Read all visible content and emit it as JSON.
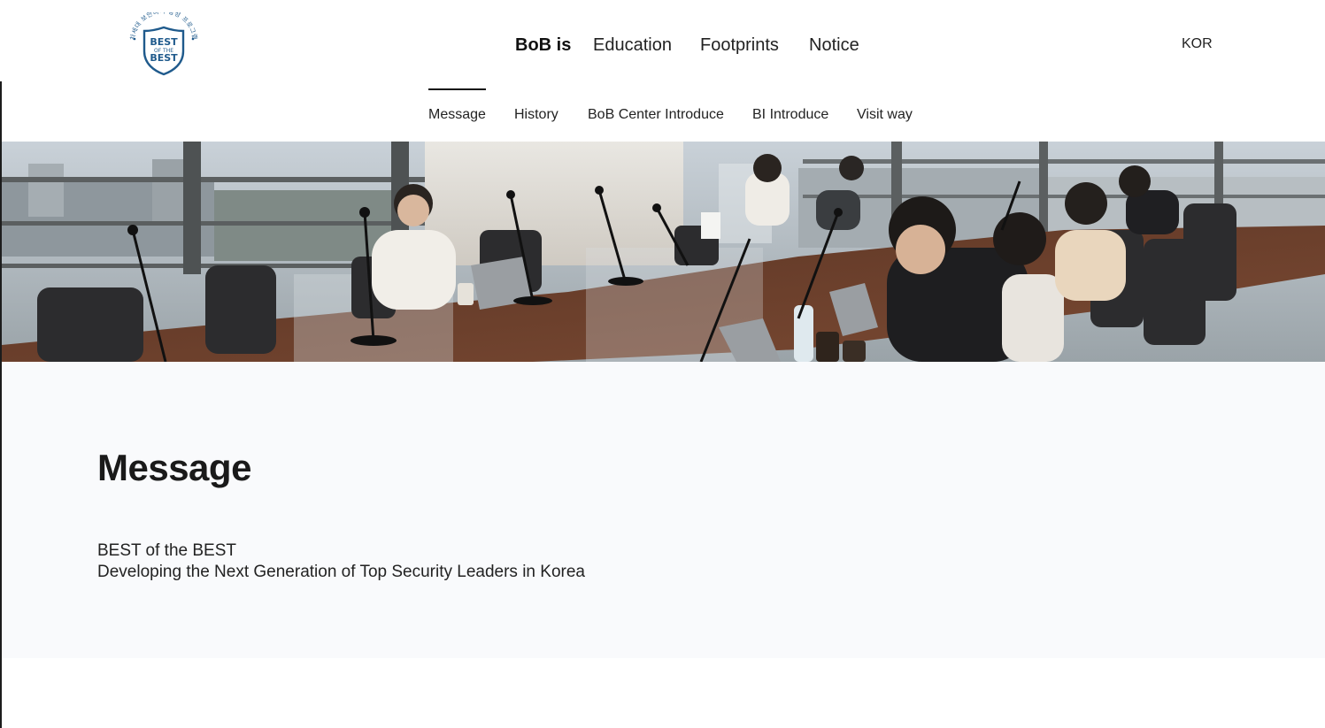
{
  "header": {
    "logo": {
      "arc_text": "차세대 보안리더 양성 프로그램",
      "lines": [
        "BEST",
        "OF THE",
        "BEST"
      ],
      "color": "#1f5a8c"
    },
    "nav": [
      {
        "label": "BoB is",
        "active": true
      },
      {
        "label": "Education",
        "active": false
      },
      {
        "label": "Footprints",
        "active": false
      },
      {
        "label": "Notice",
        "active": false
      }
    ],
    "language": "KOR"
  },
  "subnav": [
    {
      "label": "Message",
      "active": true
    },
    {
      "label": "History",
      "active": false
    },
    {
      "label": "BoB Center Introduce",
      "active": false
    },
    {
      "label": "BI Introduce",
      "active": false
    },
    {
      "label": "Visit way",
      "active": false
    }
  ],
  "content": {
    "title": "Message",
    "line1": "BEST of the BEST",
    "line2": "Developing the Next Generation of Top Security Leaders in Korea"
  }
}
